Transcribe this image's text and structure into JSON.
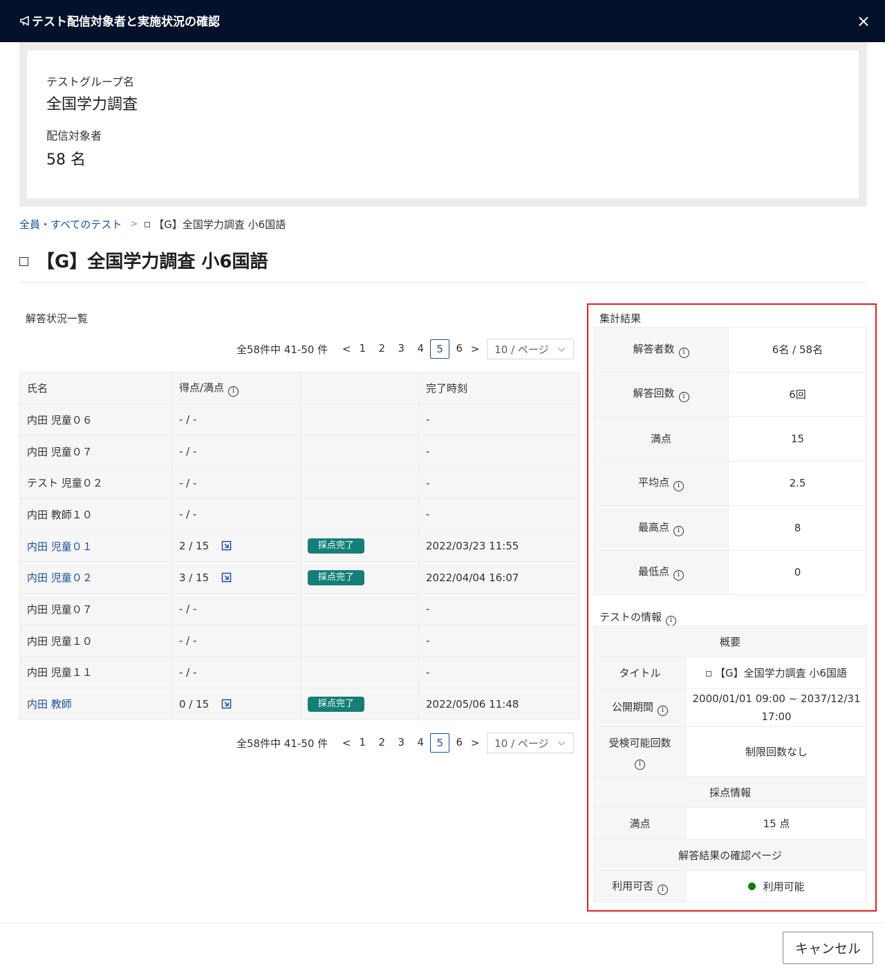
{
  "header": {
    "title": "テスト配信対象者と実施状況の確認",
    "icon": "megaphone-icon",
    "close_icon": "close-icon"
  },
  "group": {
    "name_label": "テストグループ名",
    "name_value": "全国学力調査",
    "target_label": "配信対象者",
    "target_value": "58 名"
  },
  "breadcrumb": {
    "root": "全員・すべてのテスト",
    "separator": ">",
    "current": "【G】全国学力調査 小6国語"
  },
  "page_title": "【G】全国学力調査 小6国語",
  "list_section": {
    "title": "解答状況一覧",
    "pager": {
      "summary": "全58件中 41-50 件",
      "prev": "<",
      "next": ">",
      "pages": [
        "1",
        "2",
        "3",
        "4",
        "5",
        "6"
      ],
      "active_page": "5",
      "page_size": "10 / ページ"
    },
    "columns": [
      "氏名",
      "得点/満点",
      "",
      "完了時刻"
    ],
    "rows": [
      {
        "name": "内田 児童０６",
        "score": "- / -",
        "status": "",
        "time": "-",
        "link": false
      },
      {
        "name": "内田 児童０７",
        "score": "- / -",
        "status": "",
        "time": "-",
        "link": false
      },
      {
        "name": "テスト 児童０２",
        "score": "- / -",
        "status": "",
        "time": "-",
        "link": false
      },
      {
        "name": "内田 教師１０",
        "score": "- / -",
        "status": "",
        "time": "-",
        "link": false
      },
      {
        "name": "内田 児童０１",
        "score": "2 / 15",
        "status": "採点完了",
        "time": "2022/03/23 11:55",
        "link": true
      },
      {
        "name": "内田 児童０２",
        "score": "3 / 15",
        "status": "採点完了",
        "time": "2022/04/04 16:07",
        "link": true
      },
      {
        "name": "内田 児童０７",
        "score": "- / -",
        "status": "",
        "time": "-",
        "link": false
      },
      {
        "name": "内田 児童１０",
        "score": "- / -",
        "status": "",
        "time": "-",
        "link": false
      },
      {
        "name": "内田 児童１１",
        "score": "- / -",
        "status": "",
        "time": "-",
        "link": false
      },
      {
        "name": "内田 教師",
        "score": "0 / 15",
        "status": "採点完了",
        "time": "2022/05/06 11:48",
        "link": true
      }
    ]
  },
  "aggregate": {
    "title": "集計結果",
    "rows": [
      {
        "label": "解答者数",
        "value": "6名 / 58名",
        "info": true
      },
      {
        "label": "解答回数",
        "value": "6回",
        "info": true
      },
      {
        "label": "満点",
        "value": "15",
        "info": false
      },
      {
        "label": "平均点",
        "value": "2.5",
        "info": true
      },
      {
        "label": "最高点",
        "value": "8",
        "info": true
      },
      {
        "label": "最低点",
        "value": "0",
        "info": true
      }
    ]
  },
  "test_info": {
    "title": "テストの情報",
    "overview_header": "概要",
    "title_label": "タイトル",
    "title_value": "【G】全国学力調査 小6国語",
    "period_label": "公開期間",
    "period_value_1": "2000/01/01 09:00 ~ 2037/12/31",
    "period_value_2": "17:00",
    "attempts_label": "受検可能回数",
    "attempts_value": "制限回数なし",
    "grading_header": "採点情報",
    "full_label": "満点",
    "full_value": "15 点",
    "result_header": "解答結果の確認ページ",
    "avail_label": "利用可否",
    "avail_value": "利用可能",
    "avail_color": "#107c10"
  },
  "footer": {
    "cancel_label": "キャンセル"
  },
  "colors": {
    "header_bg": "#03122a",
    "link": "#1a5096",
    "badge": "#147f76",
    "highlight_border": "#e02020"
  }
}
